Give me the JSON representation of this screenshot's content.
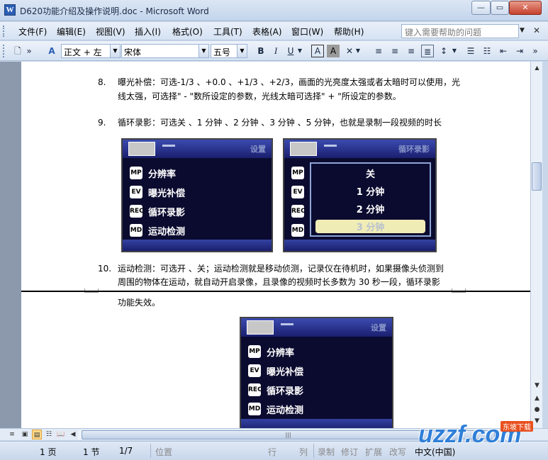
{
  "window": {
    "app_icon": "W",
    "title": "D620功能介绍及操作说明.doc - Microsoft Word",
    "minimize": "—",
    "maximize": "▭",
    "close": "✕"
  },
  "menu": {
    "items": [
      "文件(F)",
      "编辑(E)",
      "视图(V)",
      "插入(I)",
      "格式(O)",
      "工具(T)",
      "表格(A)",
      "窗口(W)",
      "帮助(H)"
    ],
    "help_placeholder": "键入需要帮助的问题",
    "close_doc": "✕"
  },
  "toolbar": {
    "style_value": "正文 + 左",
    "font_value": "宋体",
    "size_value": "五号",
    "bold": "B",
    "italic": "I",
    "underline": "U",
    "char_border": "A",
    "char_shading": "A",
    "dd": "▼"
  },
  "document": {
    "items": [
      {
        "num": "8.",
        "text": "曝光补偿：可选-1/3 、+0.0 、+1/3 、+2/3，画面的光亮度太强或者太暗时可以使用，光"
      },
      {
        "num": "",
        "text": "线太强，可选择\" - \"数所设定的参数，光线太暗可选择\" + \"所设定的参数。"
      },
      {
        "num": "9.",
        "text": "循环录影：可选关 、1 分钟 、2 分钟 、3 分钟 、5 分钟，也就是录制一段视频的时长"
      },
      {
        "num": "10.",
        "text": "运动检测：可选开 、关；运动检测就是移动侦测，记录仪在待机时，如果摄像头侦测到"
      },
      {
        "num": "",
        "text": "周围的物体在运动，就自动开启录像，且录像的视频时长多数为 30 秒一段，循环录影"
      },
      {
        "num": "",
        "text": "功能失效。"
      }
    ],
    "osd_menu": {
      "tab_label": "设置",
      "rows": [
        {
          "icon": "MP",
          "label": "分辨率"
        },
        {
          "icon": "EV",
          "label": "曝光补偿"
        },
        {
          "icon": "REC",
          "label": "循环录影"
        },
        {
          "icon": "MD",
          "label": "运动检测"
        }
      ]
    },
    "osd_submenu": {
      "tab_label": "循环录影",
      "options": [
        "关",
        "1 分钟",
        "2 分钟",
        "3 分钟"
      ],
      "selected_index": 3
    }
  },
  "scrollbar": {
    "up": "▲",
    "down": "▼",
    "select_browse": "●",
    "prev": "▲",
    "next": "▼",
    "hgrip": "|||"
  },
  "statusbar": {
    "page": "1 页",
    "section": "1 节",
    "page_of": "1/7",
    "position": "位置",
    "line": "行",
    "col": "列",
    "rec": "录制",
    "trk": "修订",
    "ext": "扩展",
    "ovr": "改写",
    "lang": "中文(中国)"
  },
  "watermark": {
    "logo": "uzzf.com",
    "sub": "东坡下载"
  }
}
